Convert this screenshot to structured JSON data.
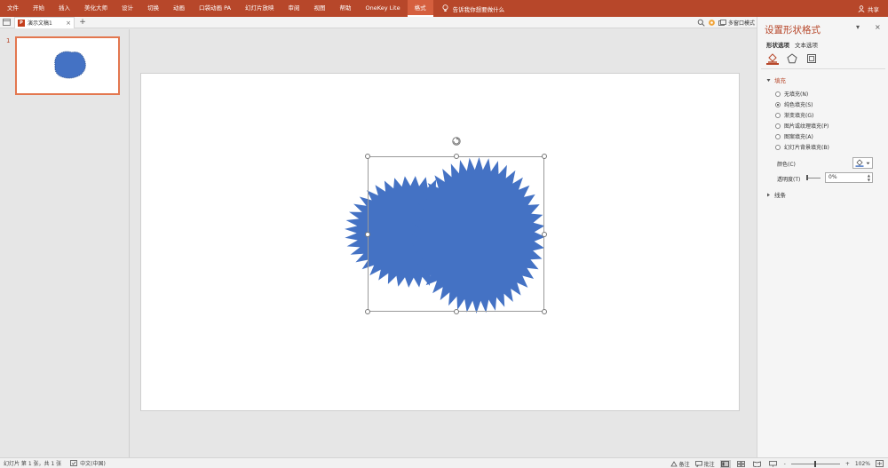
{
  "ribbon": {
    "tabs": [
      "文件",
      "开始",
      "插入",
      "美化大师",
      "设计",
      "切换",
      "动画",
      "口袋动画 PA",
      "幻灯片放映",
      "审阅",
      "视图",
      "帮助",
      "OneKey Lite",
      "格式"
    ],
    "active_tab": "格式",
    "tell_me": "告诉我你想要做什么",
    "share": "共享",
    "accent": "#b7472a"
  },
  "doc": {
    "tab_name": "演示文稿1",
    "close": "×",
    "add": "+",
    "multi_window": "多窗口模式",
    "ppt_badge": "P"
  },
  "thumbs": {
    "slide_number": "1"
  },
  "shape": {
    "fill": "#4472c4"
  },
  "pane": {
    "title": "设置形状格式",
    "dropdown": "▾",
    "close": "×",
    "tabs": [
      "形状选项",
      "文本选项"
    ],
    "fill_section": "填充",
    "fill_options": [
      {
        "label": "无填充(N)",
        "checked": false
      },
      {
        "label": "纯色填充(S)",
        "checked": true
      },
      {
        "label": "渐变填充(G)",
        "checked": false
      },
      {
        "label": "图片或纹理填充(P)",
        "checked": false
      },
      {
        "label": "图案填充(A)",
        "checked": false
      },
      {
        "label": "幻灯片背景填充(B)",
        "checked": false
      }
    ],
    "color_label": "颜色(C)",
    "transparency_label": "透明度(T)",
    "transparency_value": "0%",
    "line_section": "线条",
    "transparency_level": 0
  },
  "status": {
    "slide_info": "幻灯片 第 1 张，共 1 张",
    "language": "中文(中国)",
    "notes": "备注",
    "comments": "批注",
    "zoom_out": "-",
    "zoom_in": "+",
    "zoom": "102%",
    "zoom_level": 102
  }
}
